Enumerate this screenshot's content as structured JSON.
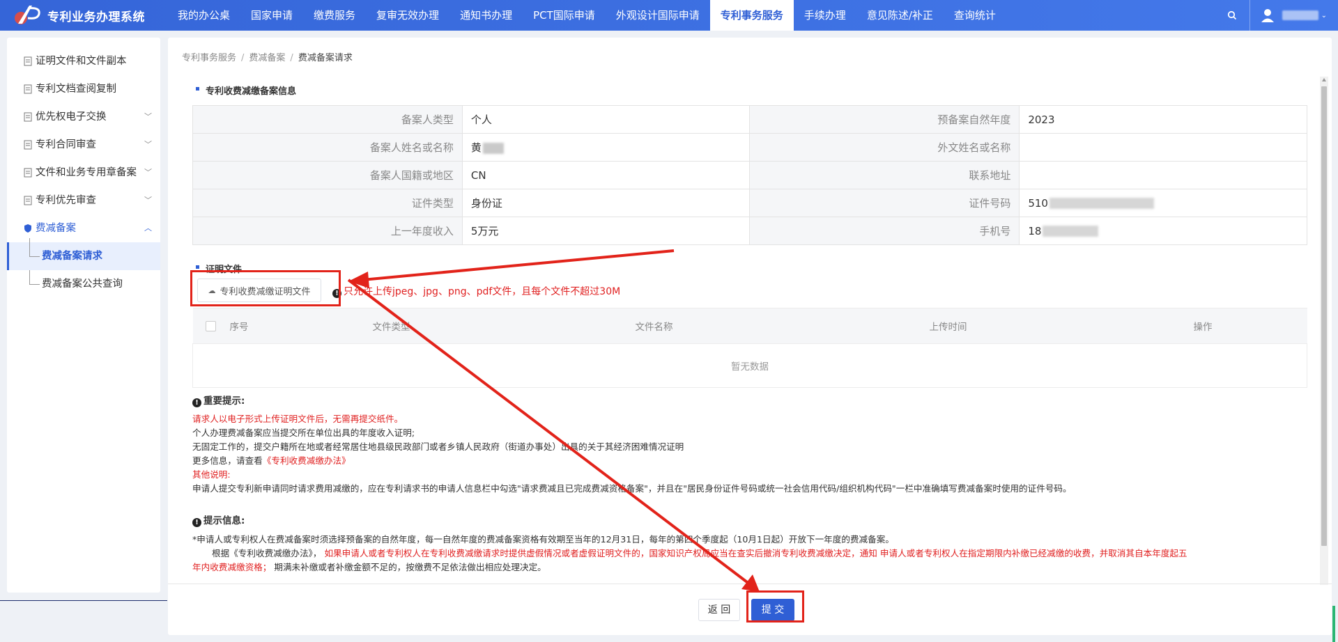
{
  "app": {
    "title": "专利业务办理系统"
  },
  "nav": {
    "items": [
      "我的办公桌",
      "国家申请",
      "缴费服务",
      "复审无效办理",
      "通知书办理",
      "PCT国际申请",
      "外观设计国际申请",
      "专利事务服务",
      "手续办理",
      "意见陈述/补正",
      "查询统计"
    ],
    "active": "专利事务服务"
  },
  "top": {
    "search_icon": "search-icon",
    "user_icon": "user-icon"
  },
  "sidebar": {
    "items": [
      {
        "label": "证明文件和文件副本",
        "icon": "doc-icon"
      },
      {
        "label": "专利文档查阅复制",
        "icon": "doc-icon"
      },
      {
        "label": "优先权电子交换",
        "icon": "doc-icon",
        "chevron": "﹀"
      },
      {
        "label": "专利合同审查",
        "icon": "doc-icon",
        "chevron": "﹀"
      },
      {
        "label": "文件和业务专用章备案",
        "icon": "doc-icon",
        "chevron": "﹀"
      },
      {
        "label": "专利优先审查",
        "icon": "doc-icon",
        "chevron": "﹀"
      },
      {
        "label": "费减备案",
        "icon": "shield-icon",
        "chevron": "︿"
      }
    ],
    "sub_items": [
      {
        "label": "费减备案请求"
      },
      {
        "label": "费减备案公共查询"
      }
    ]
  },
  "breadcrumb": [
    "专利事务服务",
    "费减备案",
    "费减备案请求"
  ],
  "section1": {
    "title": "专利收费减缴备案信息"
  },
  "info": {
    "rows": [
      {
        "l1": "备案人类型",
        "v1": "个人",
        "l2": "预备案自然年度",
        "v2": "2023"
      },
      {
        "l1": "备案人姓名或名称",
        "v1": "黄",
        "l2": "外文姓名或名称",
        "v2": ""
      },
      {
        "l1": "备案人国籍或地区",
        "v1": "CN",
        "l2": "联系地址",
        "v2": ""
      },
      {
        "l1": "证件类型",
        "v1": "身份证",
        "l2": "证件号码",
        "v2": "510"
      },
      {
        "l1": "上一年度收入",
        "v1": "5万元",
        "l2": "手机号",
        "v2": "18"
      }
    ]
  },
  "section2": {
    "title": "证明文件"
  },
  "upload": {
    "button_label": "专利收费减缴证明文件",
    "tip": "只允许上传jpeg、jpg、png、pdf文件，且每个文件不超过30M"
  },
  "file_table": {
    "columns": [
      "序号",
      "文件类型",
      "文件名称",
      "上传时间",
      "操作"
    ],
    "empty_text": "暂无数据"
  },
  "important": {
    "heading": "重要提示:",
    "lines": [
      "请求人以电子形式上传证明文件后，无需再提交纸件。",
      "个人办理费减备案应当提交所在单位出具的年度收入证明;",
      "无固定工作的，提交户籍所在地或者经常居住地县级民政部门或者乡镇人民政府（街道办事处）出具的关于其经济困难情况证明"
    ],
    "more_prefix": "更多信息，请查看",
    "more_link": "《专利收费减缴办法》",
    "other_label": "其他说明:",
    "other_text": "申请人提交专利新申请同时请求费用减缴的，应在专利请求书的申请人信息栏中勾选\"请求费减且已完成费减资格备案\"，并且在\"居民身份证件号码或统一社会信用代码/组织机构代码\"一栏中准确填写费减备案时使用的证件号码。"
  },
  "hint": {
    "heading": "提示信息:",
    "line1": "*申请人或专利权人在费减备案时须选择预备案的自然年度，每一自然年度的费减备案资格有效期至当年的12月31日，每年的第四个季度起（10月1日起）开放下一年度的费减备案。",
    "line2_black": "根据《专利收费减缴办法》，",
    "line2_red": "如果申请人或者专利权人在专利收费减缴请求时提供虚假情况或者虚假证明文件的，国家知识产权局应当在查实后撤消专利收费减缴决定，通知 申请人或者专利权人在指定期限内补缴已经减缴的收费，并取消其自本年度起五",
    "line3_red": "年内收费减缴资格；",
    "line3_black": "期满未补缴或者补缴金额不足的，按缴费不足依法做出相应处理决定。"
  },
  "footer": {
    "back_label": "返 回",
    "submit_label": "提 交"
  },
  "colors": {
    "primary": "#2f5fd5",
    "nav_bg": "#3d6fe0",
    "annotation": "#e2231a",
    "warning_text": "#e02020"
  }
}
